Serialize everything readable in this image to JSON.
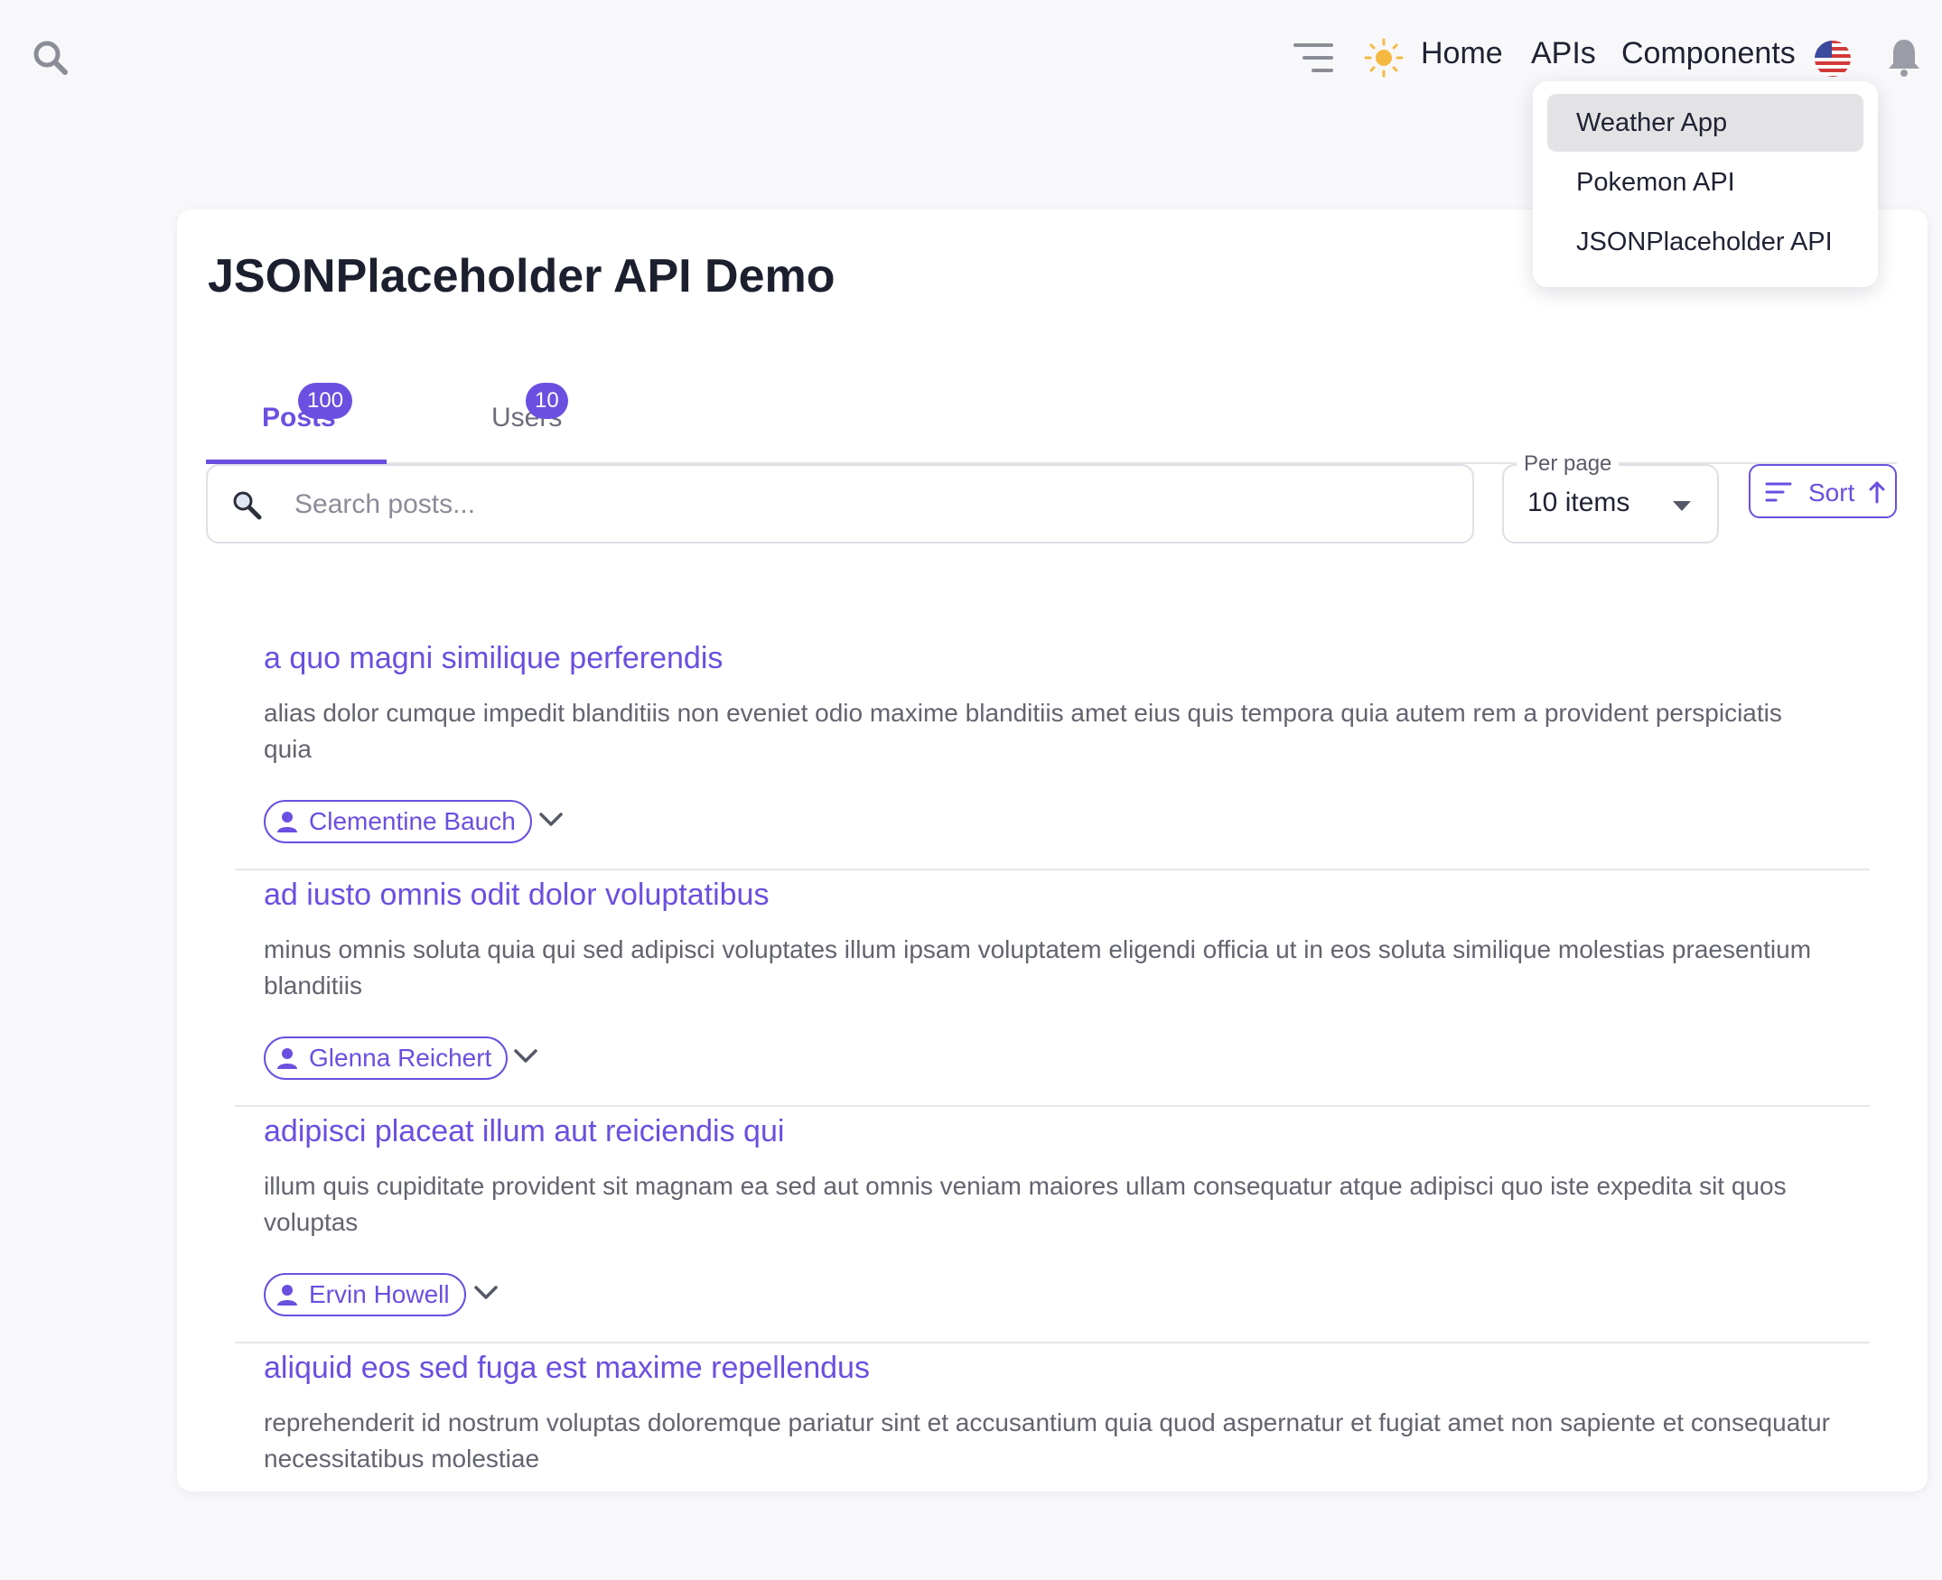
{
  "header": {
    "nav": [
      {
        "label": "Home"
      },
      {
        "label": "APIs"
      },
      {
        "label": "Components"
      }
    ],
    "icons": [
      "search-icon",
      "menu-icon",
      "sun-icon",
      "us-flag-icon",
      "bell-icon"
    ]
  },
  "apis_menu": {
    "items": [
      {
        "label": "Weather App"
      },
      {
        "label": "Pokemon API"
      },
      {
        "label": "JSONPlaceholder API"
      }
    ],
    "highlighted": "Weather App"
  },
  "page": {
    "title": "JSONPlaceholder API Demo"
  },
  "tabs": [
    {
      "label": "Posts",
      "count": "100",
      "active": true
    },
    {
      "label": "Users",
      "count": "10",
      "active": false
    }
  ],
  "toolbar": {
    "search_placeholder": "Search posts...",
    "per_page_label": "Per page",
    "per_page_value": "10 items",
    "sort_label": "Sort"
  },
  "posts": [
    {
      "title": "a quo magni similique perferendis",
      "body": "alias dolor cumque impedit blanditiis non eveniet odio maxime blanditiis amet eius quis tempora quia autem rem a provident perspiciatis quia",
      "author": "Clementine Bauch"
    },
    {
      "title": "ad iusto omnis odit dolor voluptatibus",
      "body": "minus omnis soluta quia qui sed adipisci voluptates illum ipsam voluptatem eligendi officia ut in eos soluta similique molestias praesentium blanditiis",
      "author": "Glenna Reichert"
    },
    {
      "title": "adipisci placeat illum aut reiciendis qui",
      "body": "illum quis cupiditate provident sit magnam ea sed aut omnis veniam maiores ullam consequatur atque adipisci quo iste expedita sit quos voluptas",
      "author": "Ervin Howell"
    },
    {
      "title": "aliquid eos sed fuga est maxime repellendus",
      "body": "reprehenderit id nostrum voluptas doloremque pariatur sint et accusantium quia quod aspernatur et fugiat amet non sapiente et consequatur necessitatibus molestiae",
      "author": ""
    }
  ],
  "colors": {
    "accent": "#6a4fe0",
    "background": "#f8f8fb",
    "text": "#1f2233",
    "muted": "#62646f"
  }
}
